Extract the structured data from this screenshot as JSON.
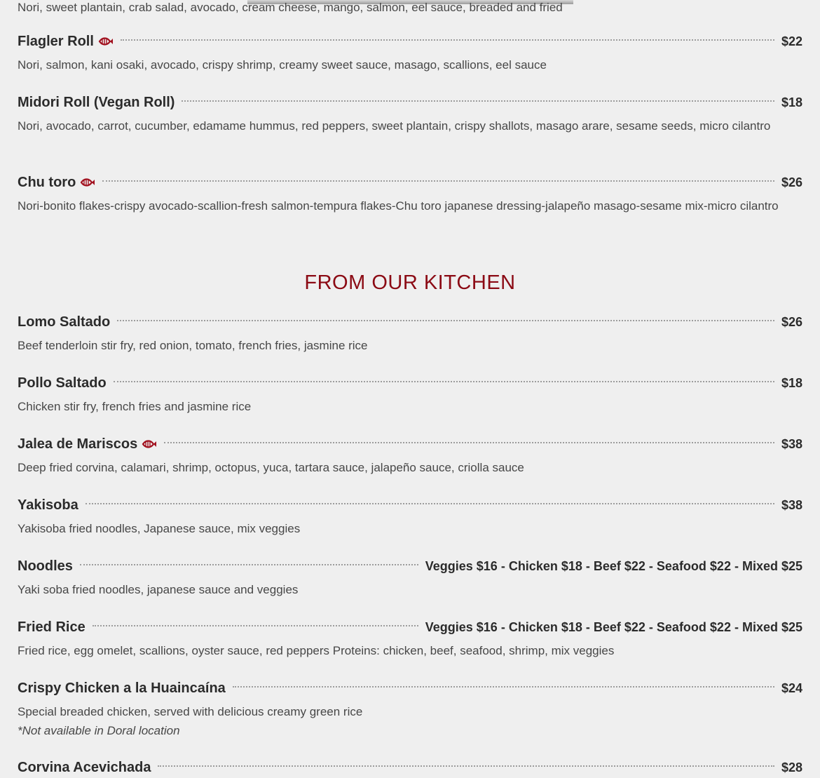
{
  "top_desc": "Nori, sweet plantain, crab salad, avocado, cream cheese, mango, salmon, eel sauce, breaded and fried",
  "items_top": [
    {
      "name": "Flagler Roll",
      "seafood": true,
      "price": "$22",
      "desc": "Nori, salmon, kani osaki, avocado, crispy shrimp, creamy sweet sauce, masago, scallions, eel sauce"
    },
    {
      "name": "Midori Roll (Vegan Roll)",
      "seafood": false,
      "price": "$18",
      "desc": "Nori, avocado, carrot, cucumber, edamame hummus, red peppers, sweet plantain, crispy shallots, masago arare, sesame seeds, micro cilantro"
    },
    {
      "name": "Chu toro",
      "seafood": true,
      "price": "$26",
      "desc": "Nori-bonito flakes-crispy avocado-scallion-fresh salmon-tempura flakes-Chu toro japanese dressing-jalapeño masago-sesame mix-micro cilantro"
    }
  ],
  "section_heading": "FROM OUR KITCHEN",
  "items_kitchen": [
    {
      "name": "Lomo Saltado",
      "seafood": false,
      "price": "$26",
      "desc": "Beef tenderloin stir fry, red onion, tomato, french fries, jasmine rice"
    },
    {
      "name": "Pollo Saltado",
      "seafood": false,
      "price": "$18",
      "desc": "Chicken stir fry, french fries and jasmine rice"
    },
    {
      "name": "Jalea de Mariscos",
      "seafood": true,
      "price": "$38",
      "desc": "Deep fried corvina, calamari, shrimp, octopus, yuca, tartara sauce, jalapeño sauce, criolla sauce"
    },
    {
      "name": "Yakisoba",
      "seafood": false,
      "price": "$38",
      "desc": "Yakisoba fried noodles, Japanese sauce, mix veggies"
    },
    {
      "name": "Noodles",
      "seafood": false,
      "price": "Veggies $16 - Chicken $18 - Beef $22 - Seafood $22 - Mixed $25",
      "desc": "Yaki soba fried noodles, japanese sauce and veggies"
    },
    {
      "name": "Fried Rice",
      "seafood": false,
      "price": "Veggies $16 - Chicken $18 - Beef $22 - Seafood $22 - Mixed $25",
      "desc": "Fried rice, egg omelet, scallions, oyster sauce, red peppers Proteins: chicken, beef, seafood, shrimp, mix veggies"
    },
    {
      "name": "Crispy Chicken a la Huaincaína",
      "seafood": false,
      "price": "$24",
      "desc": "Special breaded chicken, served with delicious creamy green rice",
      "note": "*Not available in Doral location"
    },
    {
      "name": "Corvina Acevichada",
      "seafood": false,
      "price": "$28",
      "desc": ""
    }
  ],
  "icon": {
    "seafood": "fish-icon",
    "color": "#a1101e"
  }
}
